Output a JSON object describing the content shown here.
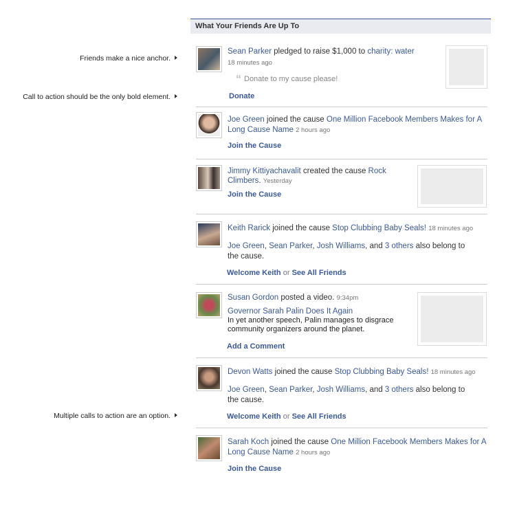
{
  "annotations": {
    "anchor": "Friends make a nice anchor.",
    "cta": "Call to action should be the only bold element.",
    "multi": "Multiple calls to action are an option."
  },
  "header": {
    "title": "What Your Friends Are Up To"
  },
  "s1": {
    "name": "Sean Parker",
    "verb": "pledged to raise $1,000 to",
    "target": "charity: water",
    "time": "18 minutes ago",
    "quote": "Donate to my cause please!",
    "cta": "Donate"
  },
  "s2": {
    "name": "Joe Green",
    "verb": "joined the cause",
    "target": "One Million Facebook Members Makes for A Long Cause Name",
    "time": "2 hours ago",
    "cta": "Join the Cause"
  },
  "s3": {
    "name": "Jimmy Kittiyachavalit",
    "verb": "created the cause",
    "target": "Rock Climbers",
    "period": ".",
    "time": "Yesterday",
    "cta": "Join the Cause"
  },
  "s4": {
    "name": "Keith Rarick",
    "verb": "joined the cause",
    "target": "Stop Clubbing Baby Seals!",
    "time": "18 minutes ago",
    "f1": "Joe Green",
    "f2": "Sean Parker",
    "f3": "Josh Williams",
    "and": ", and",
    "others": "3 others",
    "tail": "also belong to the cause.",
    "cta1": "Welcome Keith",
    "or": "or",
    "cta2": "See All Friends"
  },
  "s5": {
    "name": "Susan Gordon",
    "verb": "posted a video.",
    "time": "9:34pm",
    "video_title": "Governor Sarah Palin Does It Again",
    "video_desc": "In yet another speech, Palin manages to disgrace community organizers around the planet.",
    "cta": "Add a Comment"
  },
  "s6": {
    "name": "Devon Watts",
    "verb": "joined the cause",
    "target": "Stop Clubbing Baby Seals!",
    "time": "18 minutes ago",
    "f1": "Joe Green",
    "f2": "Sean Parker",
    "f3": "Josh Williams",
    "and": ", and",
    "others": "3 others",
    "tail": "also belong to the cause.",
    "cta1": "Welcome Keith",
    "or": "or",
    "cta2": "See All Friends"
  },
  "s7": {
    "name": "Sarah Koch",
    "verb": "joined the cause",
    "target": "One Million Facebook Members Makes for A Long Cause Name",
    "time": "2 hours ago",
    "cta": "Join the Cause"
  },
  "colors": {
    "link": "#3b5998",
    "header_bg": "#e9ebf0",
    "divider": "#cccccc"
  }
}
